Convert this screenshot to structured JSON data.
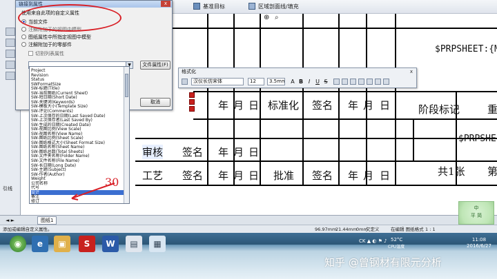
{
  "toolbar": {
    "item1": "基准目标",
    "item2": "区域剖面线/填充"
  },
  "drawing": {
    "header_var1": "$PRPSHEET:{Mat",
    "header_var2": "$PRPSHEE",
    "row1": [
      "年",
      "月",
      "日",
      "标准化",
      "签名",
      "年",
      "月",
      "日"
    ],
    "row1_extra": "阶段标记",
    "row1_extra2": "重",
    "row3": [
      "审核",
      "签名",
      "年",
      "月",
      "日"
    ],
    "row4": [
      "工艺",
      "签名",
      "年",
      "月",
      "日",
      "批准",
      "签名",
      "年",
      "月",
      "日"
    ],
    "sheet_count": "共1张",
    "edge_char": "第"
  },
  "dialog": {
    "title": "链接到属性",
    "close": "x",
    "prompt": "使用来自此项的自定义属性",
    "options": [
      {
        "label": "当前文件",
        "checked": true
      },
      {
        "label": "注解附加于的视图中模型",
        "checked": false
      },
      {
        "label": "图纸属性中所指定视图中模型",
        "checked": false
      },
      {
        "label": "注解附加于的零部件",
        "checked": false
      }
    ],
    "checkbox_label": "切割列表属性",
    "file_props_button": "文件属性(F)",
    "cancel_button": "取消"
  },
  "dropdown_items": [
    "Project",
    "Revision",
    "Status",
    "SWFormatSize",
    "SW-标题(Title)",
    "SW-当前图纸(Current Sheet)",
    "SW-短日期(Short Date)",
    "SW-关键词(Keywords)",
    "SW-模板大小(Template Size)",
    "SW-评论(Comments)",
    "SW-上次保存的日期(Last Saved Date)",
    "SW-上次保存者(Last Saved By)",
    "SW-生成的日期(Created Date)",
    "SW-视图比例(View Scale)",
    "SW-视图名称(View Name)",
    "SW-图纸比例(Sheet Scale)",
    "SW-图纸格式大小(Sheet Format Size)",
    "SW-图纸名称(Sheet Name)",
    "SW-图纸总数(Total Sheets)",
    "SW-文件夹名称(Folder Name)",
    "SW-文件名称(File Name)",
    "SW-长日期(Long Date)",
    "SW-主题(Subject)",
    "SW-作者(Author)",
    "Weight",
    "公司名称",
    "代号",
    "设计",
    "备注",
    "修订"
  ],
  "dropdown_selected_index": 27,
  "annotation": {
    "number": "30"
  },
  "format_toolbar": {
    "title": "格式化",
    "close": "x",
    "font": "汉仪长仿宋体",
    "size": "12",
    "height": "3.5mm",
    "bold": "B",
    "italic": "I",
    "underline": "U",
    "strike": "S"
  },
  "left_panel": {
    "tab_ref": "引线",
    "tab_sheet": "图纸1"
  },
  "status": {
    "left": "添加或编辑自定义属性。",
    "x": "96.97mm",
    "y": "21.44mm",
    "z": "0mm",
    "state": "欠定义",
    "mode": "在编辑 图纸格式",
    "scale": "1 : 1"
  },
  "taskbar": {
    "time": "11:08",
    "date": "2016/6/27",
    "temp": "52°C",
    "cpu": "CPU温度"
  },
  "deco": {
    "line1": "中",
    "line2": "平 简"
  },
  "watermark": "知乎 @曾钢材有限元分析"
}
